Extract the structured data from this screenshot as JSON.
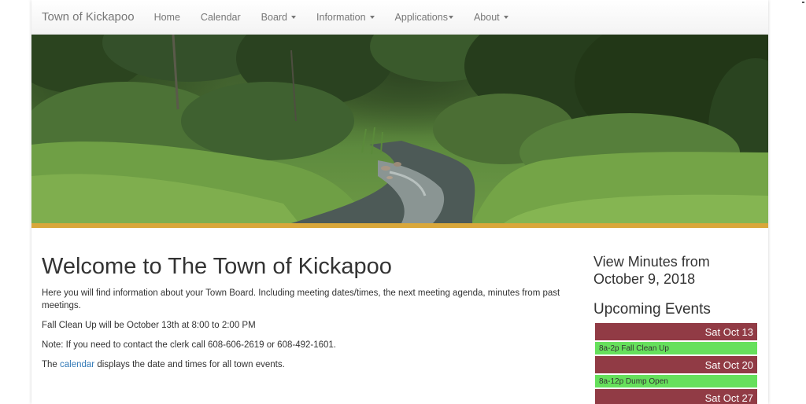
{
  "navbar": {
    "brand": "Town of Kickapoo",
    "items": [
      {
        "label": "Home"
      },
      {
        "label": "Calendar"
      },
      {
        "label": "Board"
      },
      {
        "label": "Information"
      },
      {
        "label": "Applications"
      },
      {
        "label": "About"
      }
    ]
  },
  "main": {
    "title": "Welcome to The Town of Kickapoo",
    "intro": "Here you will find information about your Town Board. Including meeting dates/times, the next meeting agenda, minutes from past meetings.",
    "cleanup": "Fall Clean Up will be October 13th at 8:00 to 2:00 PM",
    "contact": "Note: If you need to contact the clerk call 608-606-2619 or 608-492-1601.",
    "calendar_prefix": "The ",
    "calendar_link": "calendar",
    "calendar_suffix": " displays the date and times for all town events."
  },
  "sidebar": {
    "minutes_link": "View Minutes from October 9, 2018",
    "events_title": "Upcoming Events",
    "events": [
      {
        "date": "Sat Oct 13",
        "item": "8a-2p Fall Clean Up"
      },
      {
        "date": "Sat Oct 20",
        "item": "8a-12p Dump Open"
      },
      {
        "date": "Sat Oct 27"
      }
    ]
  },
  "colors": {
    "day_header": "#913b45",
    "event_item": "#66e05c",
    "accent_bar": "#d9a73a",
    "link": "#337ab7"
  }
}
